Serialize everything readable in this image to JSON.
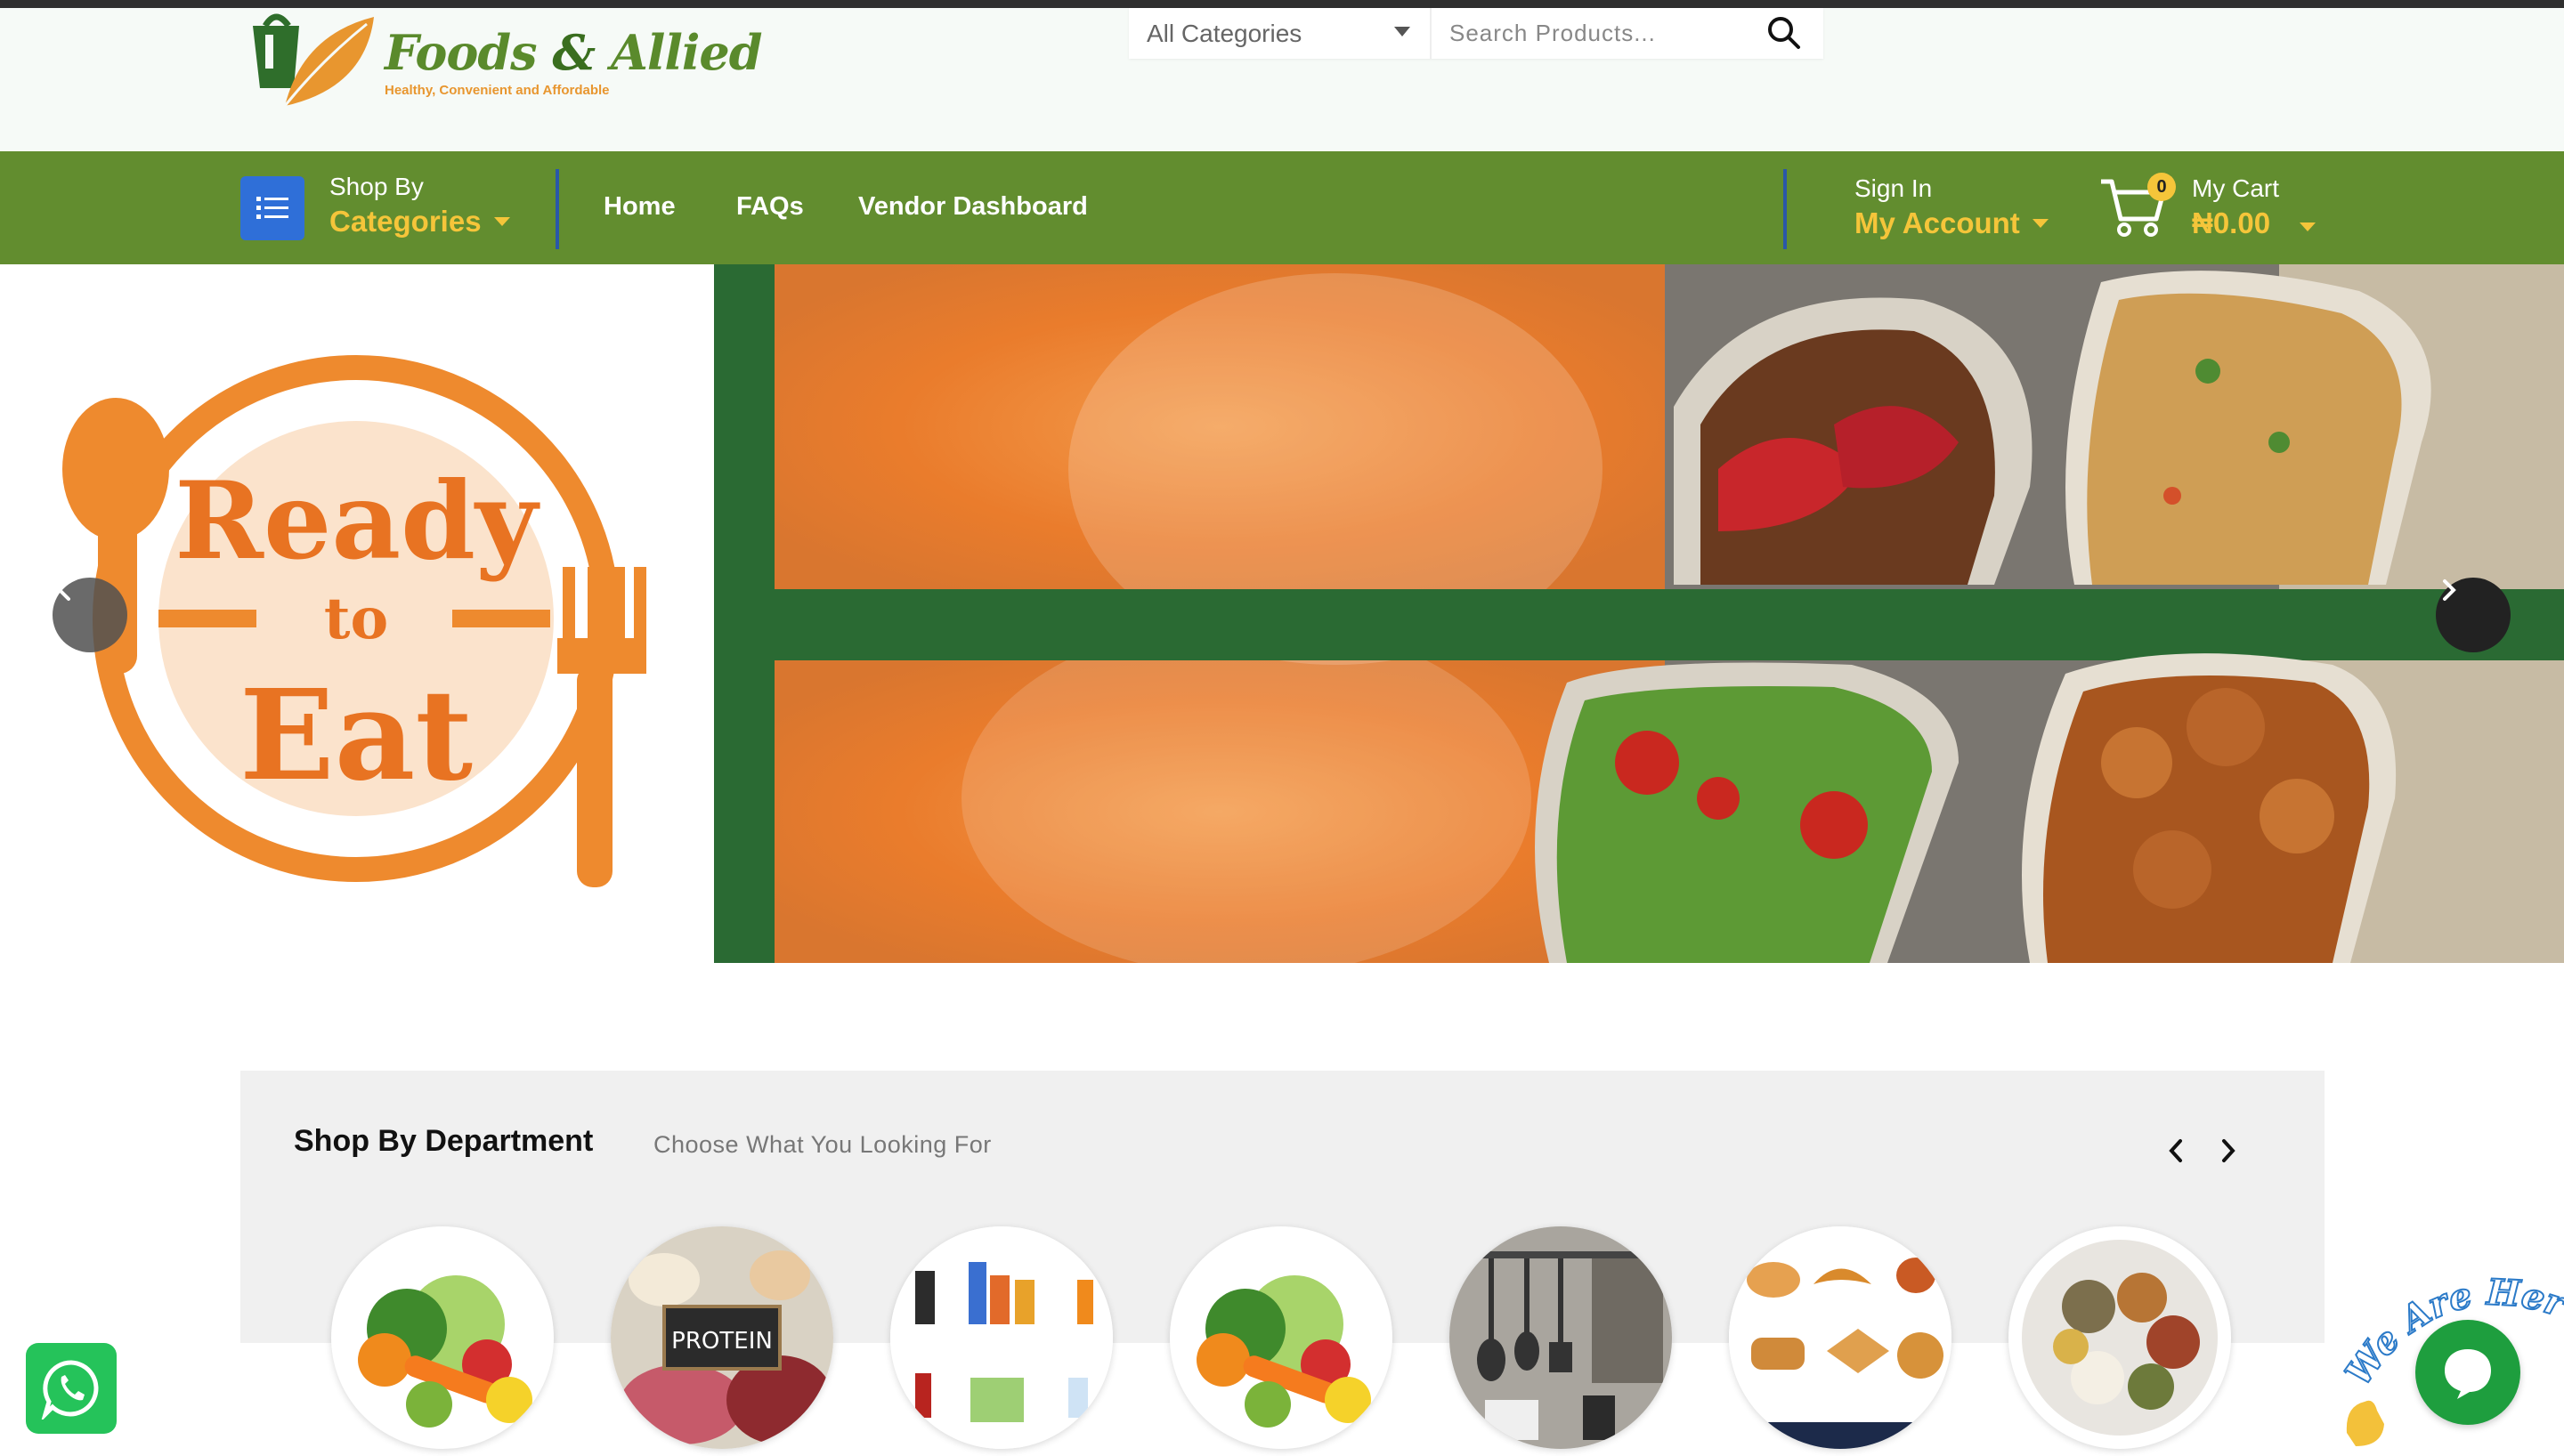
{
  "brand": {
    "name_part1": "Foods",
    "name_amp": "&",
    "name_part2": "Allied",
    "tagline": "Healthy, Convenient and Affordable"
  },
  "search": {
    "category_selected": "All Categories",
    "placeholder": "Search Products..."
  },
  "nav": {
    "shop_by": "Shop By",
    "categories": "Categories",
    "links": [
      "Home",
      "FAQs",
      "Vendor Dashboard"
    ],
    "sign_in": "Sign In",
    "my_account": "My Account",
    "my_cart": "My Cart",
    "cart_count": "0",
    "cart_total": "₦0.00"
  },
  "hero": {
    "badge_line1": "Ready",
    "badge_line2": "to",
    "badge_line3": "Eat"
  },
  "departments": {
    "title": "Shop By Department",
    "subtitle": "Choose What You Looking For",
    "items": [
      {
        "name": "vegetables",
        "label": ""
      },
      {
        "name": "protein",
        "label": "PROTEIN"
      },
      {
        "name": "drinks",
        "label": ""
      },
      {
        "name": "vegetables-2",
        "label": ""
      },
      {
        "name": "kitchen-utensils",
        "label": ""
      },
      {
        "name": "pastries",
        "label": ""
      },
      {
        "name": "spices",
        "label": ""
      }
    ]
  },
  "chat": {
    "banner": "We Are Here!"
  },
  "colors": {
    "nav_green": "#628d2f",
    "accent_yellow": "#f5c53a",
    "category_blue": "#2f6fd8",
    "hero_green": "#2a6a33",
    "ready_orange": "#ee8a2e",
    "whatsapp_green": "#25c35a"
  }
}
